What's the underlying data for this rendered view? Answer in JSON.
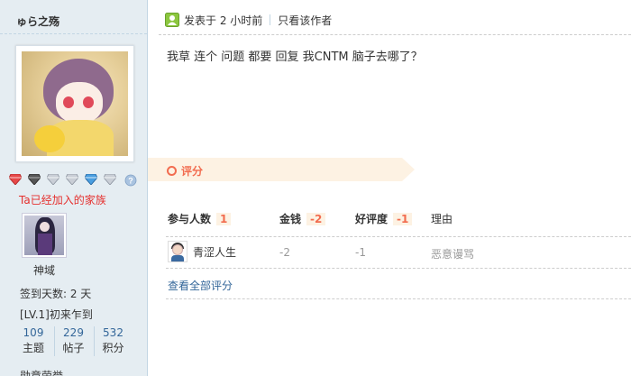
{
  "user": {
    "name": "ゅら之殇",
    "family_text": "Ta已经加入的家族",
    "group_name": "神域",
    "sign_days": "签到天数: 2 天",
    "level": "[LV.1]初来乍到",
    "counters": [
      {
        "value": "109",
        "label": "主题"
      },
      {
        "value": "229",
        "label": "帖子"
      },
      {
        "value": "532",
        "label": "积分"
      }
    ],
    "cut_line": "勋章荣誉"
  },
  "medal_icons": [
    "red-gem-icon",
    "dark-gem-icon",
    "silver-gem-icon",
    "silver-gem-icon",
    "blue-gem-icon",
    "silver-gem-icon",
    "question-badge-icon"
  ],
  "post": {
    "posted_at": "发表于 2 小时前",
    "author_only": "只看该作者",
    "body": "我草 连个 问题 都要 回复 我CNTM 脑子去哪了？"
  },
  "rating": {
    "title": "评分",
    "headers": {
      "participants": "参与人数",
      "participants_count": "1",
      "money": "金钱",
      "money_total": "-2",
      "reputation": "好评度",
      "reputation_total": "-1",
      "reason": "理由"
    },
    "rows": [
      {
        "user": "青涩人生",
        "money": "-2",
        "reputation": "-1",
        "reason": "恶意谩骂"
      }
    ],
    "view_all": "查看全部评分"
  },
  "colors": {
    "sidebar_bg": "#e5edf2",
    "accent_orange": "#f26c4f",
    "link_blue": "#336699",
    "family_red": "#e5302e"
  }
}
